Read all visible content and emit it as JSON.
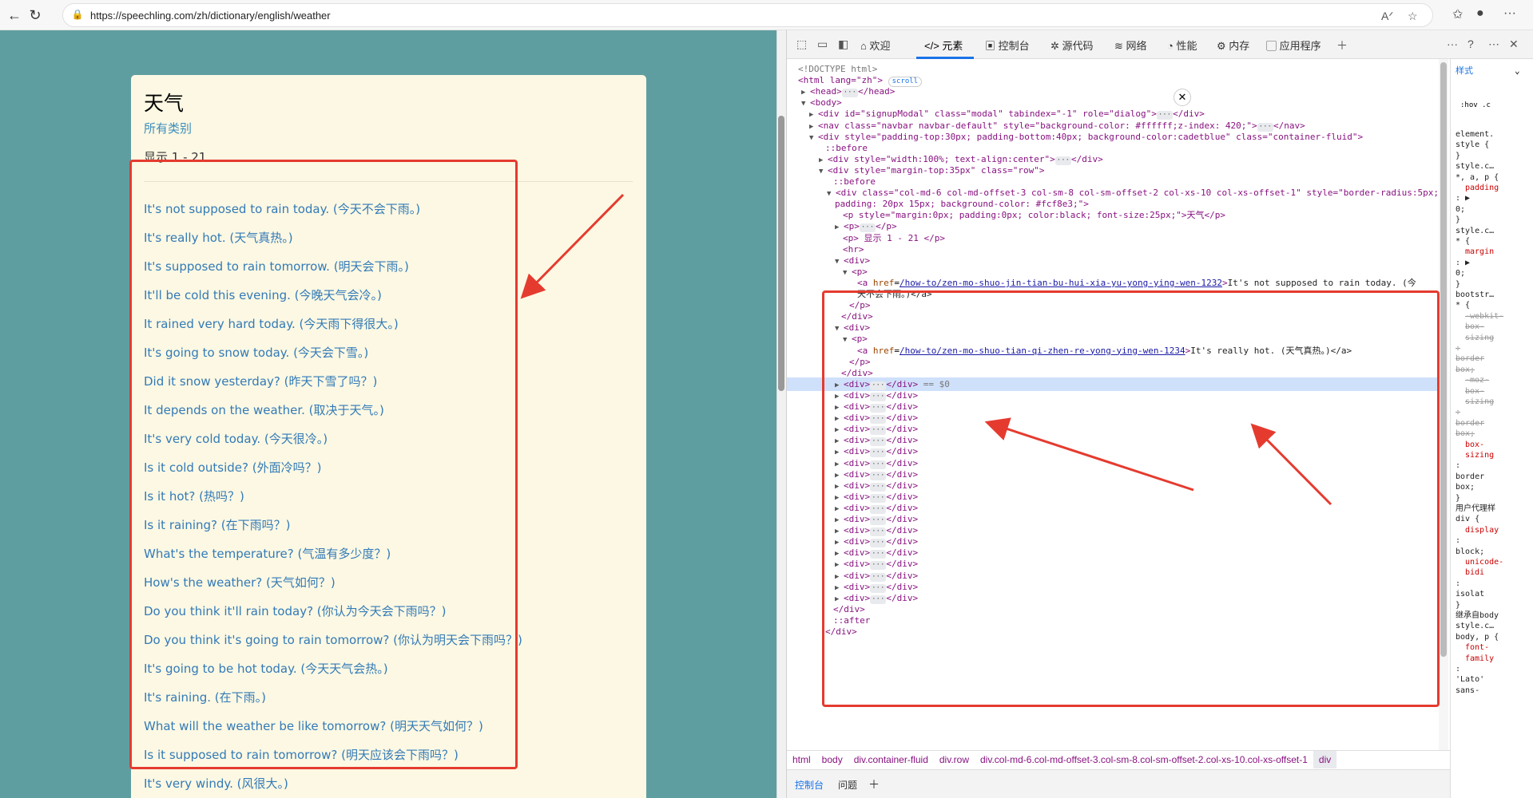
{
  "browser": {
    "url": "https://speechling.com/zh/dictionary/english/weather"
  },
  "page": {
    "title": "天气",
    "category_link": "所有类别",
    "count_text": "显示 1 - 21",
    "phrases": [
      "It's not supposed to rain today. (今天不会下雨。)",
      "It's really hot. (天气真热。)",
      "It's supposed to rain tomorrow. (明天会下雨。)",
      "It'll be cold this evening. (今晚天气会冷。)",
      "It rained very hard today. (今天雨下得很大。)",
      "It's going to snow today. (今天会下雪。)",
      "Did it snow yesterday? (昨天下雪了吗？)",
      "It depends on the weather. (取决于天气。)",
      "It's very cold today. (今天很冷。)",
      "Is it cold outside? (外面冷吗？)",
      "Is it hot? (热吗？)",
      "Is it raining? (在下雨吗？)",
      "What's the temperature? (气温有多少度？)",
      "How's the weather? (天气如何？)",
      "Do you think it'll rain today? (你认为今天会下雨吗？)",
      "Do you think it's going to rain tomorrow? (你认为明天会下雨吗？)",
      "It's going to be hot today. (今天天气会热。)",
      "It's raining. (在下雨。)",
      "What will the weather be like tomorrow? (明天天气如何？)",
      "Is it supposed to rain tomorrow? (明天应该会下雨吗？)",
      "It's very windy. (风很大。)"
    ]
  },
  "devtools": {
    "tabs": [
      "欢迎",
      "元素",
      "控制台",
      "源代码",
      "网络",
      "性能",
      "内存",
      "应用程序"
    ],
    "active_tab": "元素",
    "styles_tab": "样式",
    "filter_hov": ":hov .c",
    "breadcrumbs": [
      "html",
      "body",
      "div.container-fluid",
      "div.row",
      "div.col-md-6.col-md-offset-3.col-sm-8.col-sm-offset-2.col-xs-10.col-xs-offset-1",
      "div"
    ],
    "drawer_tabs": [
      "控制台",
      "问题"
    ],
    "dom": {
      "doctype": "<!DOCTYPE html>",
      "html_open": "<html lang=\"zh\">",
      "scroll_badge": "scroll",
      "head": "<head>",
      "head_close": "</head>",
      "body_open": "<body>",
      "modal_div": "<div id=\"signupModal\" class=\"modal\" tabindex=\"-1\" role=\"dialog\">",
      "nav": "<nav class=\"navbar navbar-default\" style=\"background-color: #ffffff;z-index: 420;\">",
      "container": "<div style=\"padding-top:30px; padding-bottom:40px; background-color:cadetblue\" class=\"container-fluid\">",
      "before": "::before",
      "center_div": "<div style=\"width:100%; text-align:center\">",
      "row_div": "<div style=\"margin-top:35px\" class=\"row\">",
      "col_div_1": "<div class=\"col-md-6 col-md-offset-3 col-sm-8 col-sm-offset-2 col-xs-10 col-xs-offset-1\" style=\"border-radius:5px;",
      "col_div_2": "padding: 20px 15px; background-color: #fcf8e3;\">",
      "p_title": "<p style=\"margin:0px; padding:0px; color:black; font-size:25px;\">天气</p>",
      "p_collapsed": "<p>",
      "p_count": "<p> 显示 1 - 21 </p>",
      "hr": "<hr>",
      "div_open": "<div>",
      "p_open": "<p>",
      "a1_href": "/how-to/zen-mo-shuo-jin-tian-bu-hui-xia-yu-yong-ying-wen-1232",
      "a1_text": "It's not supposed to rain today. (今",
      "a1_text_cont": "天不会下雨。)</a>",
      "p_close": "</p>",
      "div_close": "</div>",
      "a2_href": "/how-to/zen-mo-shuo-tian-qi-zhen-re-yong-ying-wen-1234",
      "a2_text": "It's really hot. (天气真热。)</a>",
      "selected_marker": "== $0",
      "after": "::after"
    },
    "styles": [
      "element.",
      "style {",
      "}",
      "style.c…",
      "*, a, p {",
      "padding",
      ": ▶",
      "0;",
      "}",
      "style.c…",
      "* {",
      "margin",
      ": ▶",
      "0;",
      "}",
      "bootstr…",
      "* {",
      "-webkit-",
      "box-",
      "sizing",
      ":",
      "border",
      "box;",
      "-moz-",
      "box-",
      "sizing",
      ":",
      "border",
      "box;",
      "box-",
      "sizing",
      ":",
      "border",
      "box;",
      "}",
      "用户代理样",
      "div {",
      "display",
      ":",
      "block;",
      "unicode-",
      "bidi",
      ":",
      "isolat",
      "}",
      "继承自body",
      "style.c…",
      "body, p {",
      "font-",
      "family",
      ":",
      "'Lato'",
      "sans-"
    ]
  },
  "colors": {
    "page_bg": "#5f9ea0",
    "card_bg": "#fcf8e3",
    "link": "#337ab7",
    "annotation_red": "#e53b2f"
  }
}
